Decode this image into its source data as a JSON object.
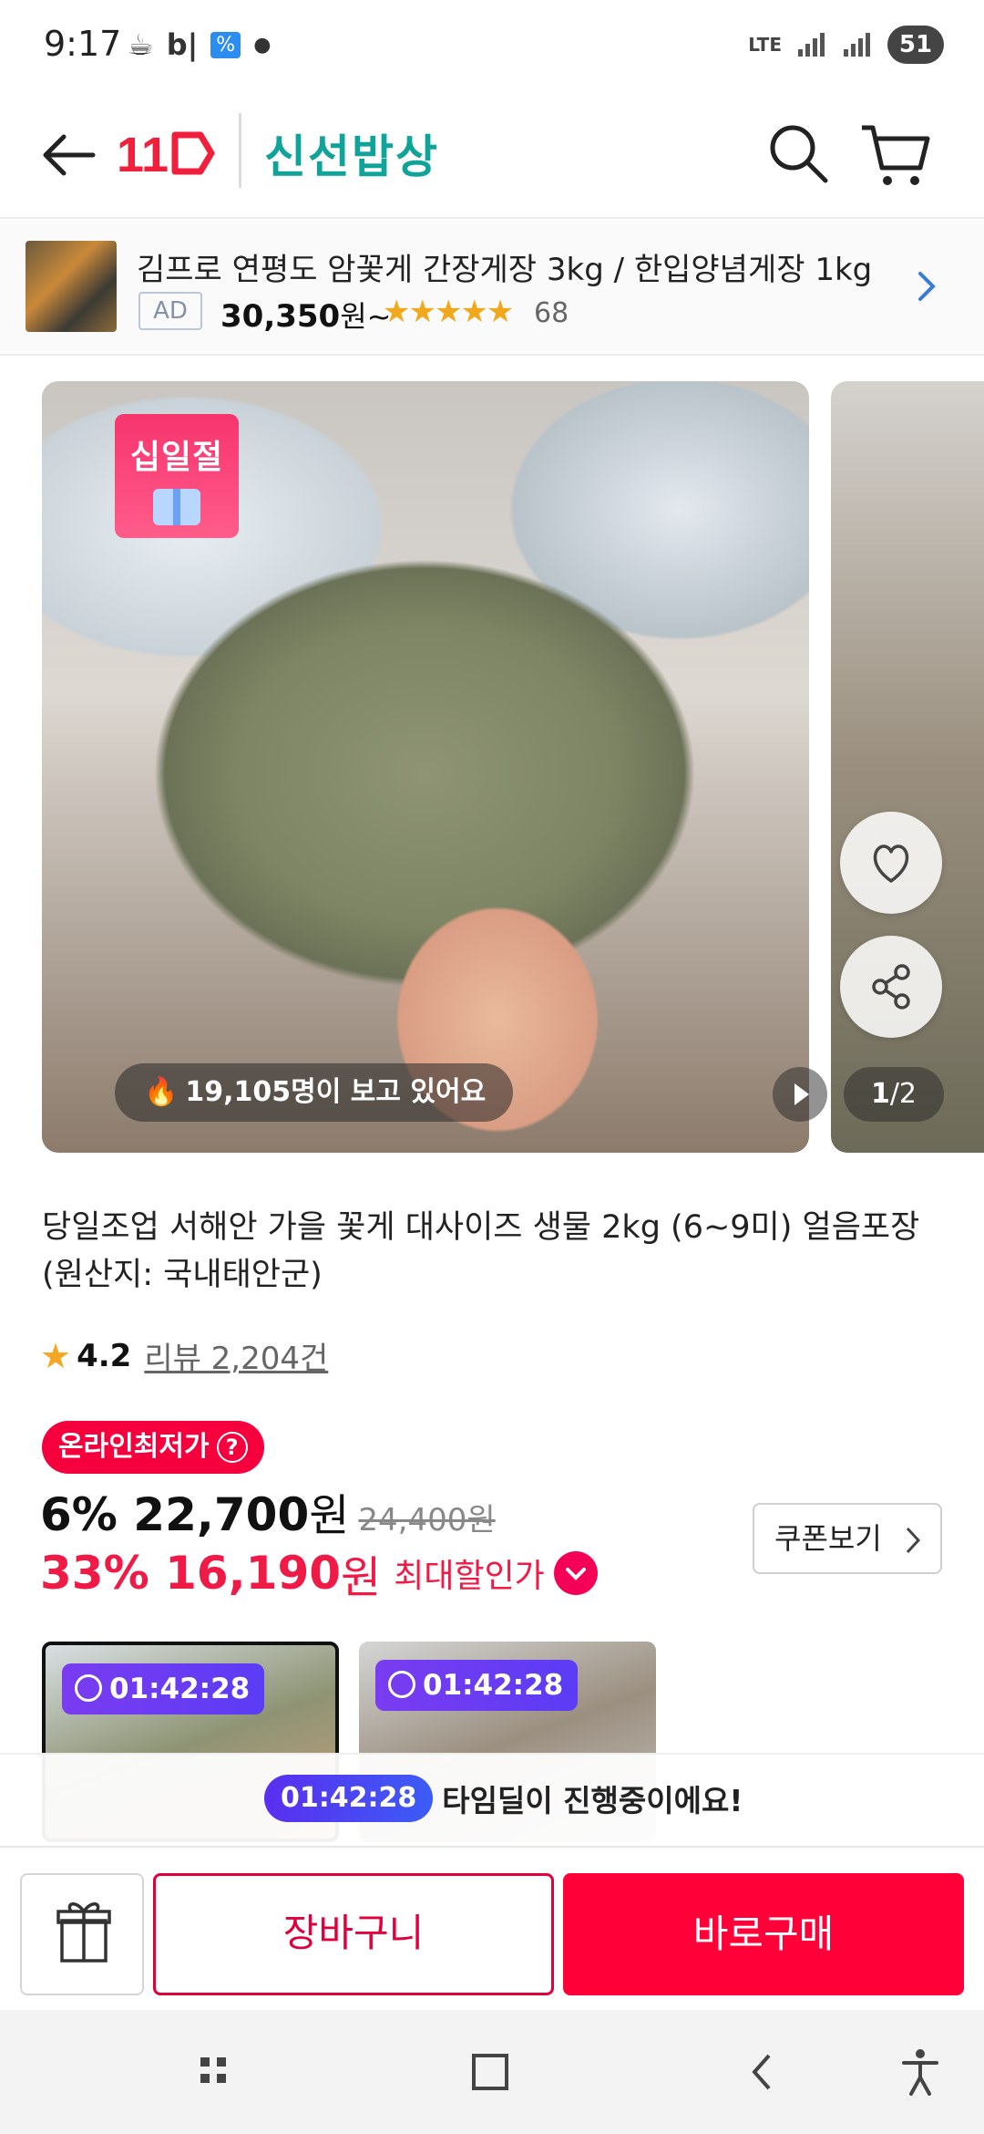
{
  "status_bar": {
    "time": "9:17",
    "network": "LTE",
    "battery": "51"
  },
  "header": {
    "logo": "11",
    "brand": "신선밥상"
  },
  "ad": {
    "title": "김프로 연평도 암꽃게 간장게장 3kg / 한입양념게장 1kg",
    "badge": "AD",
    "price": "30,350",
    "price_unit": "원~",
    "stars": "★★★★★",
    "review_count": "68"
  },
  "gallery": {
    "event_badge": "십일절",
    "viewers": "19,105명이 보고 있어요",
    "page_current": "1",
    "page_total": "/2"
  },
  "product": {
    "title": "당일조업 서해안 가을 꽃게 대사이즈 생물 2kg (6~9미) 얼음포장 (원산지: 국내태안군)",
    "rating": "4.2",
    "reviews": "리뷰 2,204건",
    "lowest_price_badge": "온라인최저가",
    "discount1": "6% 22,700",
    "won": "원",
    "original_price": "24,400원",
    "discount2": "33% 16,190",
    "max_discount_label": "최대할인가",
    "coupon_button": "쿠폰보기"
  },
  "thumbnails": [
    {
      "timer": "01:42:28"
    },
    {
      "timer": "01:42:28"
    }
  ],
  "time_deal": {
    "timer": "01:42:28",
    "text": "타임딜이 진행중이에요!"
  },
  "actions": {
    "cart": "장바구니",
    "buy": "바로구매"
  },
  "colors": {
    "brand_teal": "#10a39a",
    "primary_red": "#ff0038",
    "timer_purple": "#5b3cf5"
  }
}
